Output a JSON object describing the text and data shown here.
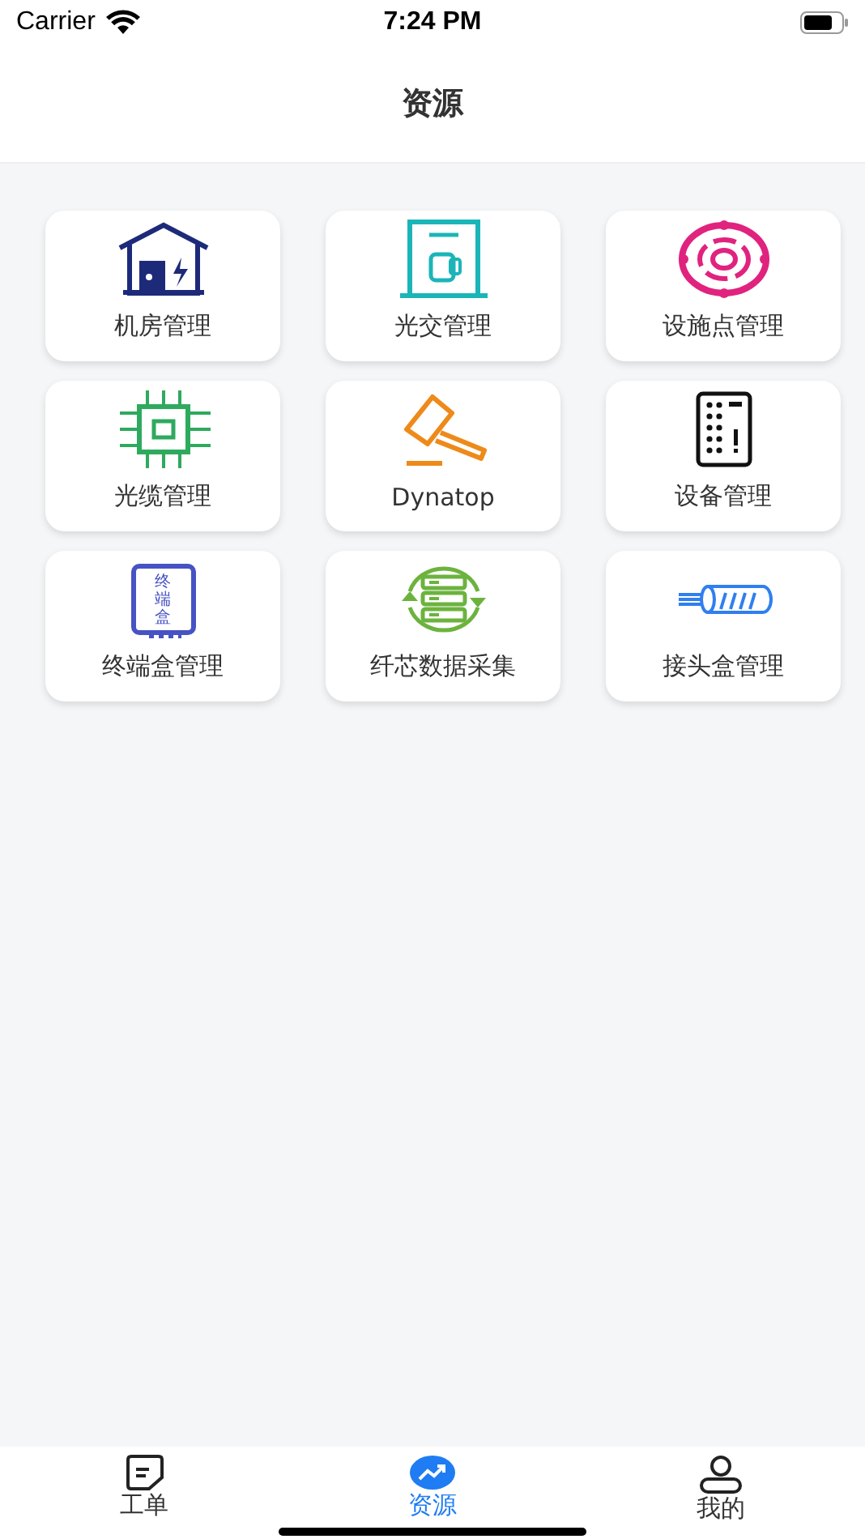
{
  "status_bar": {
    "carrier": "Carrier",
    "time": "7:24 PM"
  },
  "nav": {
    "title": "资源"
  },
  "tiles": [
    {
      "label": "机房管理",
      "kind": "house"
    },
    {
      "label": "光交管理",
      "kind": "cabinet"
    },
    {
      "label": "设施点管理",
      "kind": "target"
    },
    {
      "label": "光缆管理",
      "kind": "chip"
    },
    {
      "label": "Dynatop",
      "kind": "hammer"
    },
    {
      "label": "设备管理",
      "kind": "device"
    },
    {
      "label": "终端盒管理",
      "kind": "termbox",
      "icon_text": [
        "终",
        "端",
        "盒"
      ]
    },
    {
      "label": "纤芯数据采集",
      "kind": "server"
    },
    {
      "label": "接头盒管理",
      "kind": "cable"
    }
  ],
  "tab_bar": [
    {
      "label": "工单",
      "kind": "note",
      "selected": false
    },
    {
      "label": "资源",
      "kind": "trend",
      "selected": true
    },
    {
      "label": "我的",
      "kind": "person",
      "selected": false
    }
  ]
}
